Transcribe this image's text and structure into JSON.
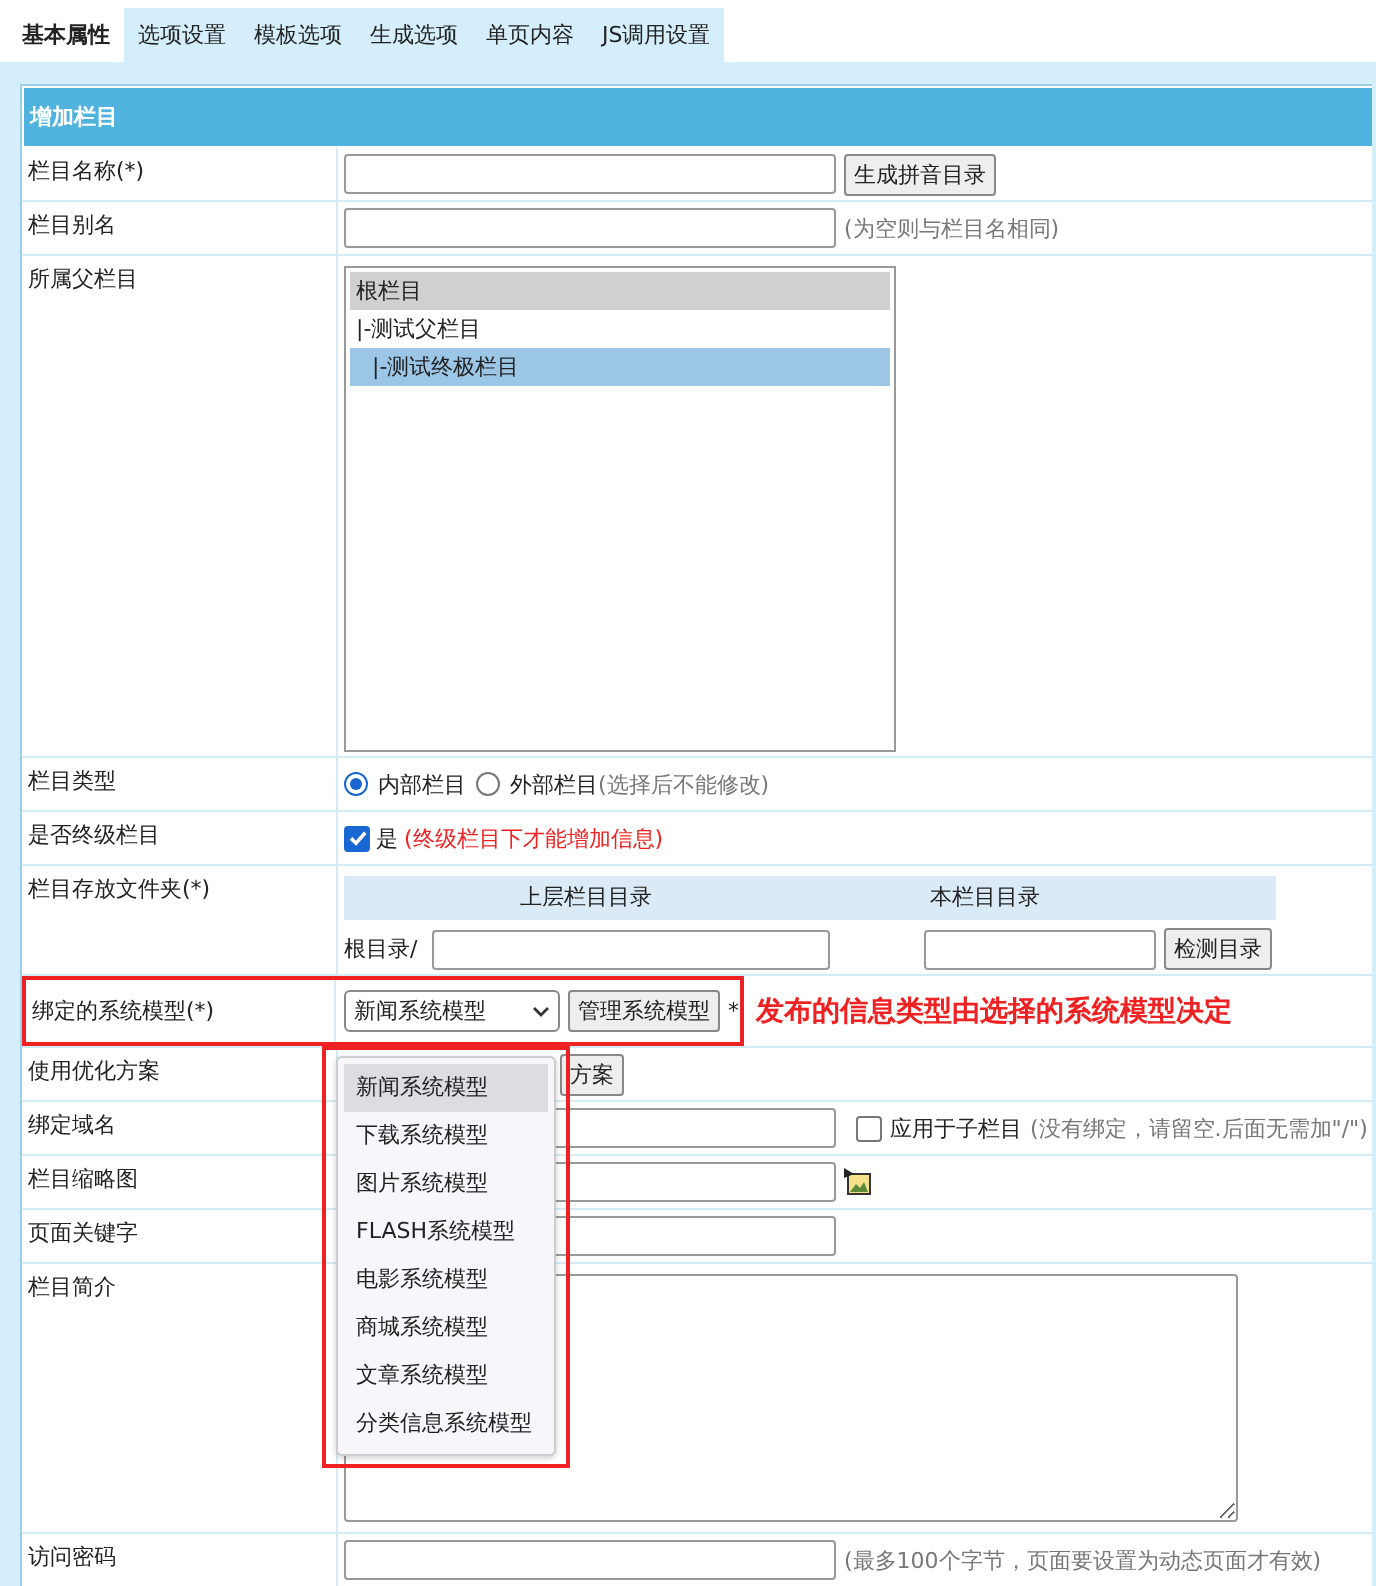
{
  "tabs": [
    {
      "label": "基本属性",
      "selected": true
    },
    {
      "label": "选项设置",
      "selected": false
    },
    {
      "label": "模板选项",
      "selected": false
    },
    {
      "label": "生成选项",
      "selected": false
    },
    {
      "label": "单页内容",
      "selected": false
    },
    {
      "label": "JS调用设置",
      "selected": false
    }
  ],
  "panel": {
    "title": "增加栏目",
    "rows": [
      {
        "kind": "input",
        "label": "栏目名称(*)",
        "button": "生成拼音目录"
      },
      {
        "kind": "input",
        "label": "栏目别名",
        "hint": "(为空则与栏目名相同)"
      },
      {
        "kind": "listbox",
        "label": "所属父栏目",
        "options": [
          {
            "label": "根栏目",
            "kind": "root",
            "selected": false
          },
          {
            "label": "|-测试父栏目",
            "kind": "item",
            "selected": false,
            "children": [
              {
                "label": "|-测试终极栏目",
                "kind": "item",
                "selected": true
              }
            ]
          }
        ]
      },
      {
        "kind": "radio",
        "label": "栏目类型",
        "options": [
          {
            "label": "内部栏目",
            "selected": true
          },
          {
            "label": "外部栏目",
            "selected": false
          }
        ],
        "hint": "(选择后不能修改)"
      },
      {
        "kind": "checkbox",
        "label": "是否终级栏目",
        "checked": true,
        "text": "是",
        "hint": "(终级栏目下才能增加信息)"
      },
      {
        "kind": "folder",
        "label": "栏目存放文件夹(*)",
        "headers": [
          "上层栏目目录",
          "本栏目目录"
        ],
        "prefix": "根目录/",
        "button": "检测目录"
      },
      {
        "kind": "select",
        "label": "绑定的系统模型(*)",
        "value": "新闻系统模型",
        "button": "管理系统模型",
        "mark": "*",
        "highlighted": true,
        "annotation": "发布的信息类型由选择的系统模型决定",
        "dropdown": [
          {
            "label": "新闻系统模型",
            "selected": true
          },
          {
            "label": "下载系统模型",
            "selected": false
          },
          {
            "label": "图片系统模型",
            "selected": false
          },
          {
            "label": "FLASH系统模型",
            "selected": false
          },
          {
            "label": "电影系统模型",
            "selected": false
          },
          {
            "label": "商城系统模型",
            "selected": false
          },
          {
            "label": "文章系统模型",
            "selected": false
          },
          {
            "label": "分类信息系统模型",
            "selected": false
          }
        ]
      },
      {
        "kind": "button",
        "label": "使用优化方案",
        "button": "方案"
      },
      {
        "kind": "input",
        "label": "绑定域名",
        "checkbox": {
          "label": "应用于子栏目",
          "checked": false
        },
        "hint": "(没有绑定，请留空.后面无需加\"/\")"
      },
      {
        "kind": "image",
        "label": "栏目缩略图"
      },
      {
        "kind": "input",
        "label": "页面关键字"
      },
      {
        "kind": "textarea",
        "label": "栏目简介"
      },
      {
        "kind": "input",
        "label": "访问密码",
        "hint": "(最多100个字节，页面要设置为动态页面才有效)"
      }
    ]
  }
}
